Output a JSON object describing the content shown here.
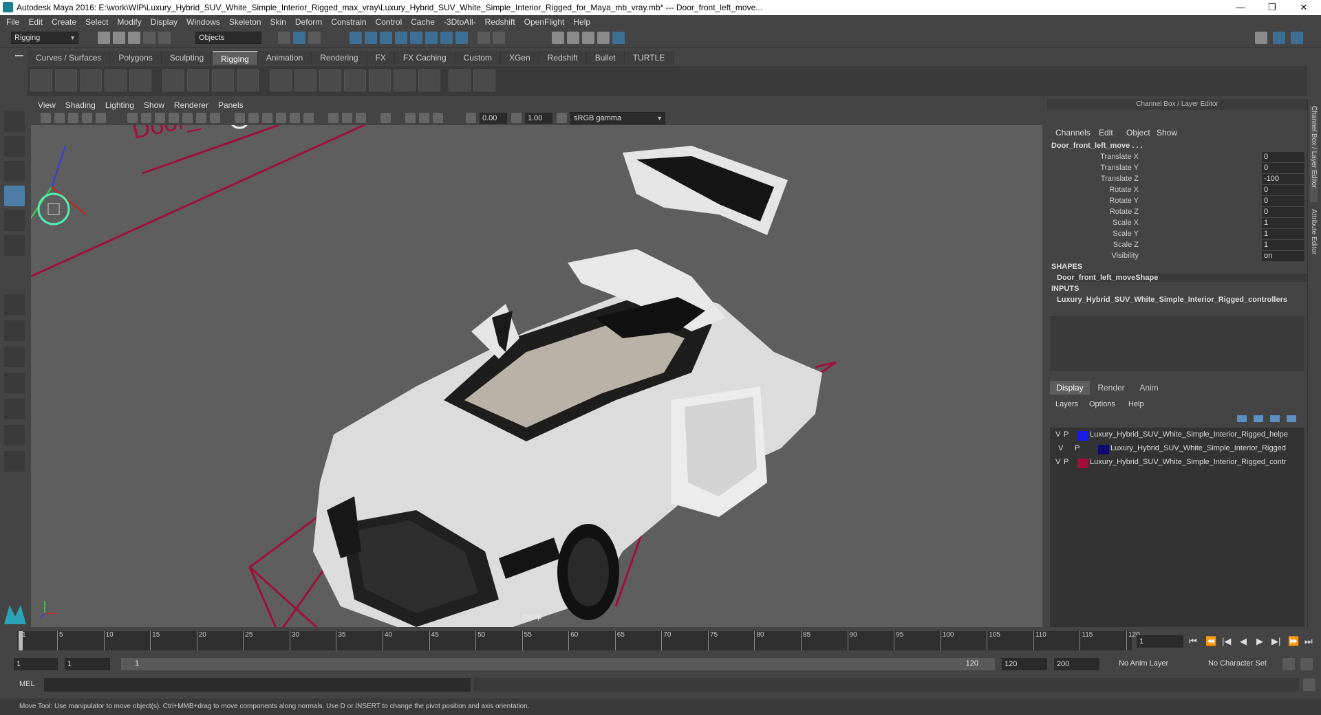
{
  "window": {
    "title": "Autodesk Maya 2016: E:\\work\\WIP\\Luxury_Hybrid_SUV_White_Simple_Interior_Rigged_max_vray\\Luxury_Hybrid_SUV_White_Simple_Interior_Rigged_for_Maya_mb_vray.mb*    ---    Door_front_left_move...",
    "minimize": "—",
    "restore": "❐",
    "close": "✕"
  },
  "menus": [
    "File",
    "Edit",
    "Create",
    "Select",
    "Modify",
    "Display",
    "Windows",
    "Skeleton",
    "Skin",
    "Deform",
    "Constrain",
    "Control",
    "Cache",
    "-3DtoAll-",
    "Redshift",
    "OpenFlight",
    "Help"
  ],
  "toolbar": {
    "mode": "Rigging",
    "selection_mode": "Objects"
  },
  "shelf_tabs": [
    "Curves / Surfaces",
    "Polygons",
    "Sculpting",
    "Rigging",
    "Animation",
    "Rendering",
    "FX",
    "FX Caching",
    "Custom",
    "XGen",
    "Redshift",
    "Bullet",
    "TURTLE"
  ],
  "active_shelf_tab": "Rigging",
  "viewport": {
    "menus": [
      "View",
      "Shading",
      "Lighting",
      "Show",
      "Renderer",
      "Panels"
    ],
    "field_a": "0.00",
    "field_b": "1.00",
    "color_space": "sRGB gamma",
    "camera_label": "persp",
    "locator_text": "Door_"
  },
  "channel_box": {
    "header": "Channel Box / Layer Editor",
    "menus": [
      "Channels",
      "Edit",
      "Object",
      "Show"
    ],
    "object_name": "Door_front_left_move . . .",
    "attributes": [
      {
        "label": "Translate X",
        "value": "0"
      },
      {
        "label": "Translate Y",
        "value": "0"
      },
      {
        "label": "Translate Z",
        "value": "-100"
      },
      {
        "label": "Rotate X",
        "value": "0"
      },
      {
        "label": "Rotate Y",
        "value": "0"
      },
      {
        "label": "Rotate Z",
        "value": "0"
      },
      {
        "label": "Scale X",
        "value": "1"
      },
      {
        "label": "Scale Y",
        "value": "1"
      },
      {
        "label": "Scale Z",
        "value": "1"
      },
      {
        "label": "Visibility",
        "value": "on"
      }
    ],
    "shapes_title": "SHAPES",
    "shape_name": "Door_front_left_moveShape",
    "inputs_title": "INPUTS",
    "input_name": "Luxury_Hybrid_SUV_White_Simple_Interior_Rigged_controllers"
  },
  "layer_editor": {
    "tabs": [
      "Display",
      "Render",
      "Anim"
    ],
    "active_tab": "Display",
    "menus": [
      "Layers",
      "Options",
      "Help"
    ],
    "layers": [
      {
        "v": "V",
        "p": "P",
        "color": "#1a1ae6",
        "name": "Luxury_Hybrid_SUV_White_Simple_Interior_Rigged_helpe"
      },
      {
        "v": "V",
        "p": "P",
        "color": "#0c0c6e",
        "name": "Luxury_Hybrid_SUV_White_Simple_Interior_Rigged"
      },
      {
        "v": "V",
        "p": "P",
        "color": "#a0103a",
        "name": "Luxury_Hybrid_SUV_White_Simple_Interior_Rigged_contr"
      }
    ]
  },
  "side_tabs": [
    "Channel Box / Layer Editor",
    "Attribute Editor"
  ],
  "timeline": {
    "ticks": [
      "1",
      "5",
      "10",
      "15",
      "20",
      "25",
      "30",
      "35",
      "40",
      "45",
      "50",
      "55",
      "60",
      "65",
      "70",
      "75",
      "80",
      "85",
      "90",
      "95",
      "100",
      "105",
      "110",
      "115",
      "120"
    ],
    "current_frame": "1"
  },
  "range": {
    "start": "1",
    "playback_start": "1",
    "slider_start": "1",
    "slider_end": "120",
    "playback_end": "120",
    "end": "200",
    "anim_layer": "No Anim Layer",
    "character_set": "No Character Set"
  },
  "mel_label": "MEL",
  "help_text": "Move Tool: Use manipulator to move object(s). Ctrl+MMB+drag to move components along normals. Use D or INSERT to change the pivot position and axis orientation."
}
